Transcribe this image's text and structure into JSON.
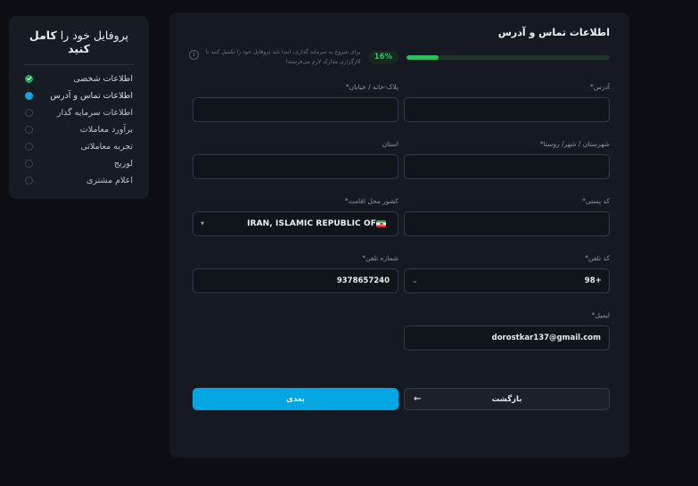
{
  "sidebar": {
    "title_normal": "پروفایل خود را ",
    "title_bold": "کامل کنید",
    "items": [
      {
        "label": "اطلاعات شخصی",
        "state": "done",
        "icon": "check-circle-icon"
      },
      {
        "label": "اطلاعات تماس و آدرس",
        "state": "active",
        "icon": "dot-icon"
      },
      {
        "label": "اطلاعات سرمایه گذار",
        "state": "todo",
        "icon": "circle-outline-icon"
      },
      {
        "label": "برآورد معاملات",
        "state": "todo",
        "icon": "circle-outline-icon"
      },
      {
        "label": "تجربه معاملاتی",
        "state": "todo",
        "icon": "circle-outline-icon"
      },
      {
        "label": "لوریج",
        "state": "todo",
        "icon": "circle-outline-icon"
      },
      {
        "label": "اعلام مشتری",
        "state": "todo",
        "icon": "circle-outline-icon"
      }
    ]
  },
  "panel": {
    "title": "اطلاعات تماس و آدرس",
    "progress_percent": "16%",
    "progress_value": 16,
    "note": "برای شروع به سرمایه گذاری، ابتدا باید پروفایل خود را تکمیل کنید تا کارگزاری مدارک لازم می‌فرستد!",
    "info_icon_glyph": "i"
  },
  "form": {
    "address": {
      "label": "آدرس",
      "required": "*",
      "value": "",
      "placeholder": ""
    },
    "street": {
      "label": "پلاک-خانه / خیابان",
      "required": "*",
      "value": "",
      "placeholder": ""
    },
    "city": {
      "label": "شهرستان / شهر/ روستا",
      "required": "*",
      "value": "",
      "placeholder": ""
    },
    "province": {
      "label": "استان",
      "required": "",
      "value": "",
      "placeholder": ""
    },
    "postal_code": {
      "label": "کد پستی",
      "required": "*",
      "value": "",
      "placeholder": ""
    },
    "country": {
      "label": "کشور محل اقامت",
      "required": "*",
      "value": "IRAN, ISLAMIC REPUBLIC OF",
      "flag": "iran-flag-icon",
      "chevron": "▾"
    },
    "phone_code": {
      "label": "کد تلفن",
      "required": "*",
      "value": "98+",
      "chevron": "⌄"
    },
    "phone_number": {
      "label": "شماره تلفن",
      "required": "*",
      "value": "9378657240",
      "placeholder": ""
    },
    "email": {
      "label": "ایمیل",
      "required": "*",
      "value": "dorostkar137@gmail.com",
      "placeholder": ""
    }
  },
  "buttons": {
    "back": {
      "label": "بازگشت",
      "arrow": "←"
    },
    "next": {
      "label": "بعدی"
    }
  },
  "colors": {
    "accent_blue": "#02a6e3",
    "progress_green": "#2ebd60",
    "badge_green_text": "#2fc26c",
    "panel_bg": "#151a22",
    "page_bg": "#0c0e13",
    "sidebar_bg": "#161b24",
    "input_border": "#333b48",
    "done_green": "#1fa84f",
    "active_blue": "#10a5e0"
  }
}
